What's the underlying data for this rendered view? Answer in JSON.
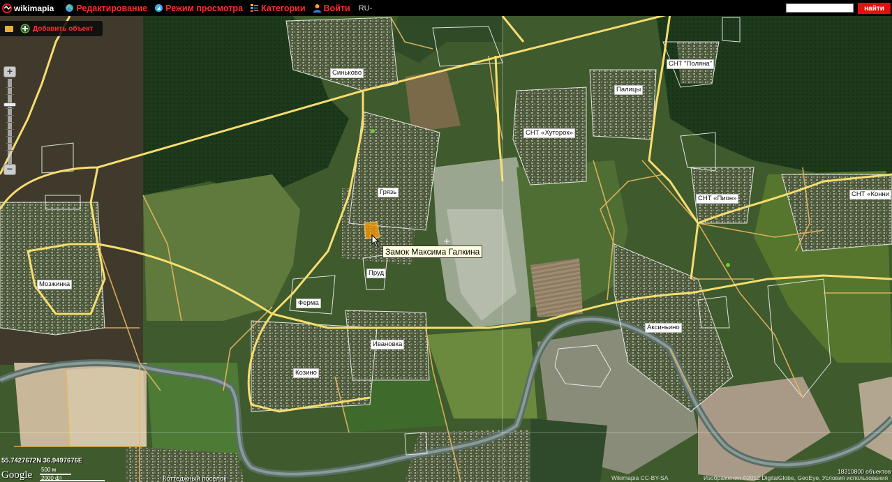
{
  "topbar": {
    "logo": "wikimapia",
    "menu": [
      {
        "label": "Редактирование",
        "icon": "edit-globe-icon"
      },
      {
        "label": "Режим просмотра",
        "icon": "compass-icon"
      },
      {
        "label": "Категории",
        "icon": "categories-icon"
      },
      {
        "label": "Войти",
        "icon": "user-icon"
      }
    ],
    "language": "RU-",
    "search_value": "",
    "search_button": "найти"
  },
  "addbar": {
    "label": "Добавить объект"
  },
  "tooltip": "Замок Максима Галкина",
  "places": {
    "sinkovo": "Синьково",
    "snt_polyana": "СНТ \"Поляна\"",
    "palitsy": "Палицы",
    "snt_khutorok": "СНТ «Хуторок»",
    "gryaz": "Грязь",
    "snt_pion": "СНТ «Пион»",
    "snt_konni": "СНТ «Конни",
    "mozzhinka": "Мозжинка",
    "prud": "Пруд",
    "ferma": "Ферма",
    "ivanovka": "Ивановка",
    "aksinino": "Аксиньино",
    "kozino": "Козино"
  },
  "footer": {
    "coordinates": "55.7427672N 36.9497676E",
    "google": "Google",
    "scale_m": "500 м",
    "scale_ft": "2000 фт",
    "bottom_place": "Коттеджный поселок",
    "wikimapia_credit": "Wikimapia CC-BY-SA",
    "imagery_credit": "Изображения ©2012 DigitalGlobe, GeoEye, Условия использования",
    "object_count": "18310800 объектов"
  },
  "colors": {
    "road": "#f5d66b",
    "object_outline": "#ffffff",
    "menu_red": "#ff2d2d",
    "highlight": "#ff9900"
  }
}
